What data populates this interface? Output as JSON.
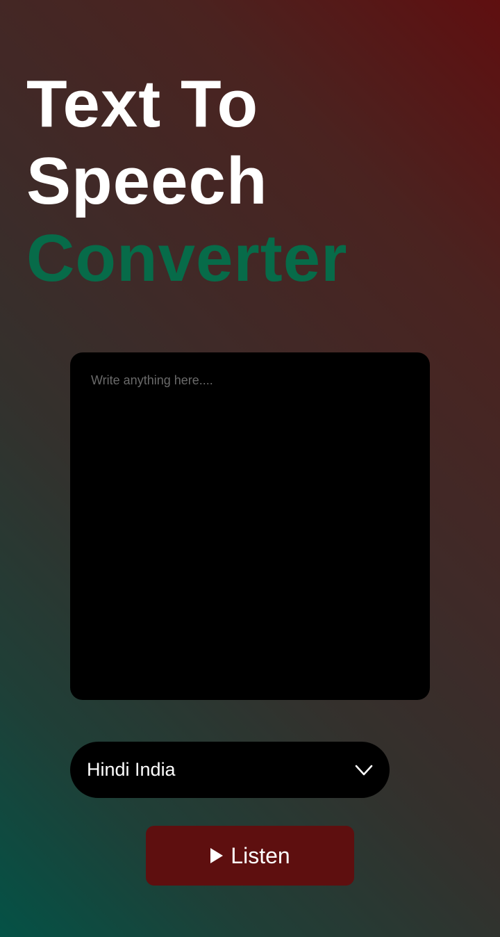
{
  "header": {
    "title_line1": "Text To",
    "title_line2": "Speech",
    "title_line3": "Converter",
    "accent_color": "#076b49"
  },
  "editor": {
    "value": "",
    "placeholder": "Write anything here...."
  },
  "voice_select": {
    "selected": "Hindi India",
    "icon": "chevron-down-icon"
  },
  "listen_button": {
    "label": "Listen",
    "icon": "play-icon",
    "color": "#5e0f0f"
  }
}
